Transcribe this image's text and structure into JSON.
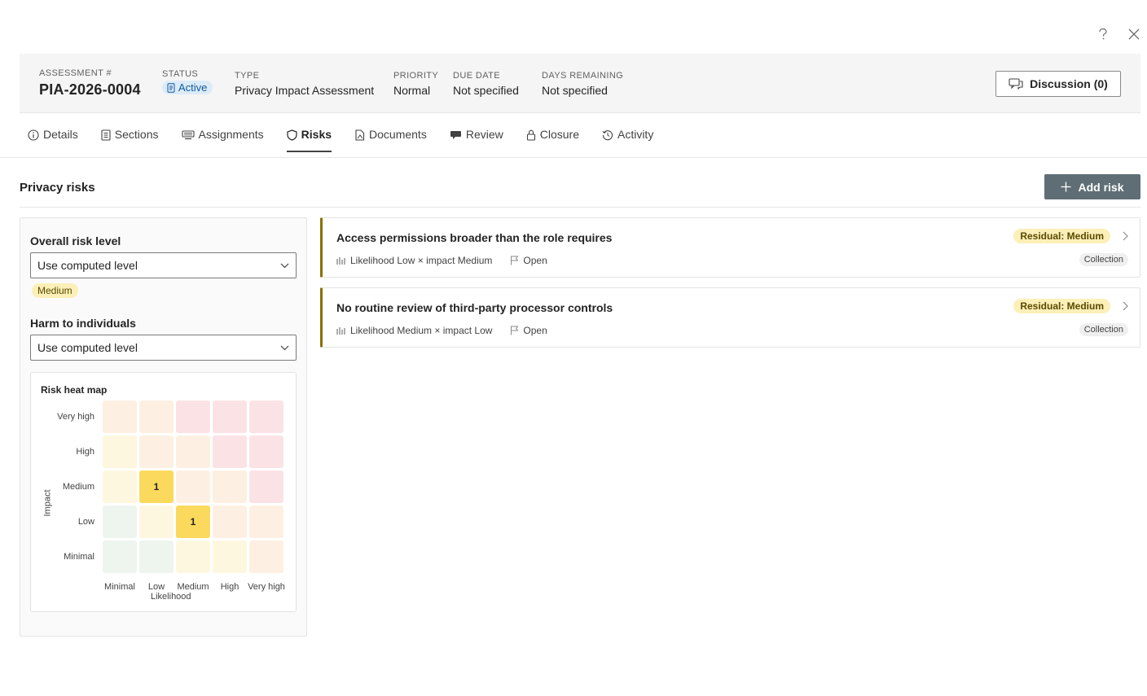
{
  "window": {
    "help_icon": "question-icon",
    "close_icon": "close-icon"
  },
  "header": {
    "assessment_label": "ASSESSMENT #",
    "assessment_id": "PIA-2026-0004",
    "status_label": "STATUS",
    "status_value": "Active",
    "type_label": "TYPE",
    "type_value": "Privacy Impact Assessment",
    "priority_label": "PRIORITY",
    "priority_value": "Normal",
    "due_label": "DUE DATE",
    "due_value": "Not specified",
    "days_label": "DAYS REMAINING",
    "days_value": "Not specified",
    "discussion_label": "Discussion (0)"
  },
  "tabs": [
    {
      "label": "Details",
      "icon": "info-icon"
    },
    {
      "label": "Sections",
      "icon": "document-list-icon"
    },
    {
      "label": "Assignments",
      "icon": "keyboard-icon"
    },
    {
      "label": "Risks",
      "icon": "shield-icon",
      "active": true
    },
    {
      "label": "Documents",
      "icon": "document-icon"
    },
    {
      "label": "Review",
      "icon": "chat-icon"
    },
    {
      "label": "Closure",
      "icon": "lock-icon"
    },
    {
      "label": "Activity",
      "icon": "history-icon"
    }
  ],
  "risks_section": {
    "title": "Privacy risks",
    "add_label": "Add risk",
    "overall_label": "Overall risk level",
    "overall_select": "Use computed level",
    "overall_level": "Medium",
    "harm_label": "Harm to individuals",
    "harm_select": "Use computed level"
  },
  "heatmap": {
    "title": "Risk heat map",
    "y_axis": "Impact",
    "x_axis": "Likelihood",
    "rows": [
      "Very high",
      "High",
      "Medium",
      "Low",
      "Minimal"
    ],
    "cols": [
      "Minimal",
      "Low",
      "Medium",
      "High",
      "Very high"
    ],
    "colors": {
      "green": "#eef5ee",
      "yellow": "#fdf7df",
      "orange": "#fdf0e2",
      "red": "#fbe3e5",
      "highlight": "#fbd95c"
    },
    "grid": [
      [
        "orange",
        "orange",
        "red",
        "red",
        "red"
      ],
      [
        "yellow",
        "orange",
        "orange",
        "red",
        "red"
      ],
      [
        "yellow",
        "highlight",
        "orange",
        "orange",
        "red"
      ],
      [
        "green",
        "yellow",
        "highlight",
        "orange",
        "orange"
      ],
      [
        "green",
        "green",
        "yellow",
        "yellow",
        "orange"
      ]
    ],
    "counts": [
      [
        "",
        "",
        "",
        "",
        ""
      ],
      [
        "",
        "",
        "",
        "",
        ""
      ],
      [
        "",
        "1",
        "",
        "",
        ""
      ],
      [
        "",
        "",
        "1",
        "",
        ""
      ],
      [
        "",
        "",
        "",
        "",
        ""
      ]
    ]
  },
  "risk_cards": [
    {
      "title": "Access permissions broader than the role requires",
      "likelihood_text": "Likelihood Low × impact Medium",
      "status": "Open",
      "residual": "Residual: Medium",
      "tag": "Collection"
    },
    {
      "title": "No routine review of third-party processor controls",
      "likelihood_text": "Likelihood Medium × impact Low",
      "status": "Open",
      "residual": "Residual: Medium",
      "tag": "Collection"
    }
  ],
  "accent_colors": {
    "risk_border": "#8a7000",
    "status_pill": "#dcebf8",
    "add_button": "#5f6e75"
  }
}
